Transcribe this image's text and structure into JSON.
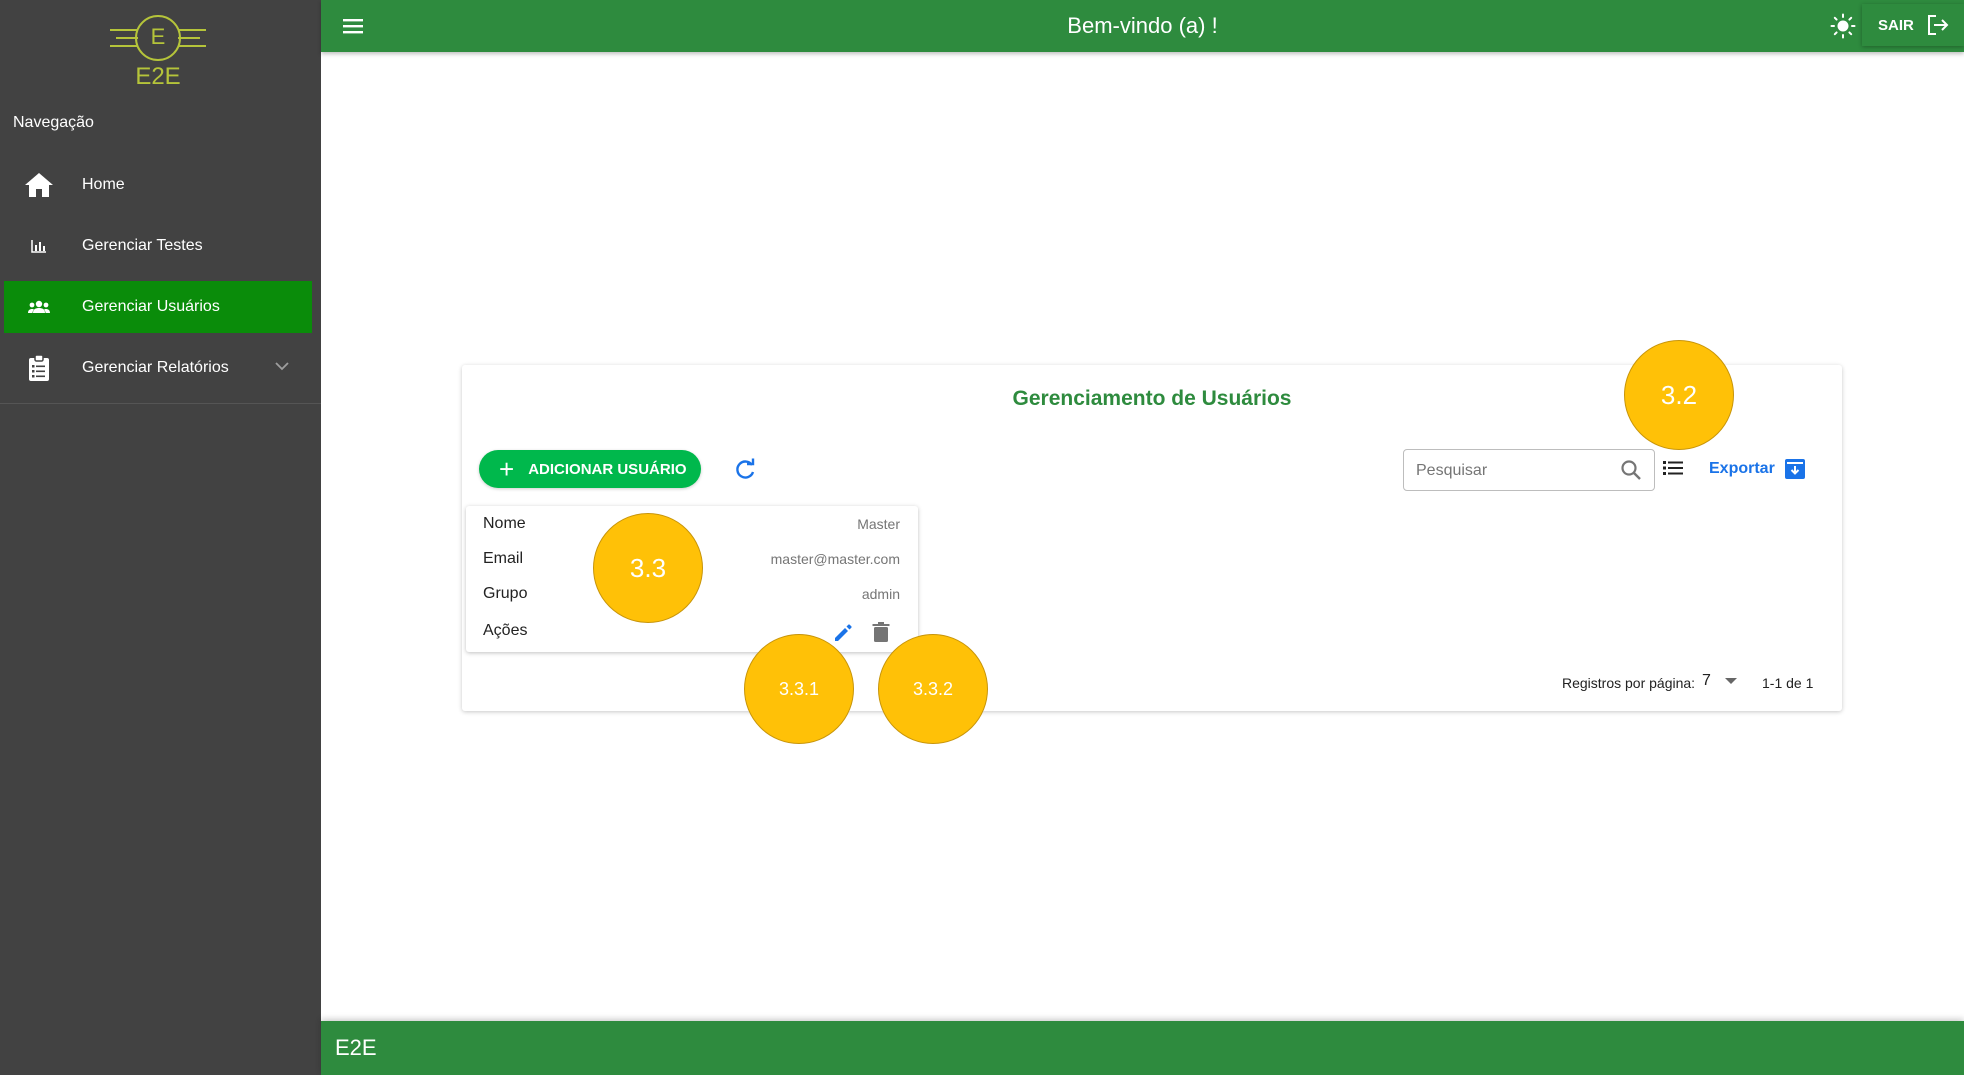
{
  "sidebar": {
    "logo_text": "E2E",
    "logo_letter": "E",
    "heading": "Navegação",
    "items": [
      {
        "label": "Home",
        "icon": "home-icon"
      },
      {
        "label": "Gerenciar Testes",
        "icon": "bar-chart-icon"
      },
      {
        "label": "Gerenciar Usuários",
        "icon": "users-icon",
        "active": true
      },
      {
        "label": "Gerenciar Relatórios",
        "icon": "clipboard-icon",
        "expandable": true
      }
    ]
  },
  "header": {
    "title": "Bem-vindo (a) !",
    "logout_label": "SAIR"
  },
  "main": {
    "title": "Gerenciamento de Usuários",
    "add_button": "ADICIONAR USUÁRIO",
    "search_placeholder": "Pesquisar",
    "export_label": "Exportar",
    "record": {
      "fields": [
        {
          "label": "Nome",
          "value": "Master"
        },
        {
          "label": "Email",
          "value": "master@master.com"
        },
        {
          "label": "Grupo",
          "value": "admin"
        },
        {
          "label": "Ações",
          "value": ""
        }
      ]
    },
    "pagination": {
      "rows_label": "Registros por página:",
      "rows_value": "7",
      "range": "1-1 de 1"
    }
  },
  "markers": {
    "m32": "3.2",
    "m33": "3.3",
    "m331": "3.3.1",
    "m332": "3.3.2"
  },
  "footer": {
    "text": "E2E"
  },
  "colors": {
    "primary_green": "#2e8b3e",
    "active_nav": "#0a8c0a",
    "add_button": "#00b84c",
    "sidebar": "#424242",
    "link_blue": "#1a73e8",
    "marker_yellow": "#ffc107"
  }
}
